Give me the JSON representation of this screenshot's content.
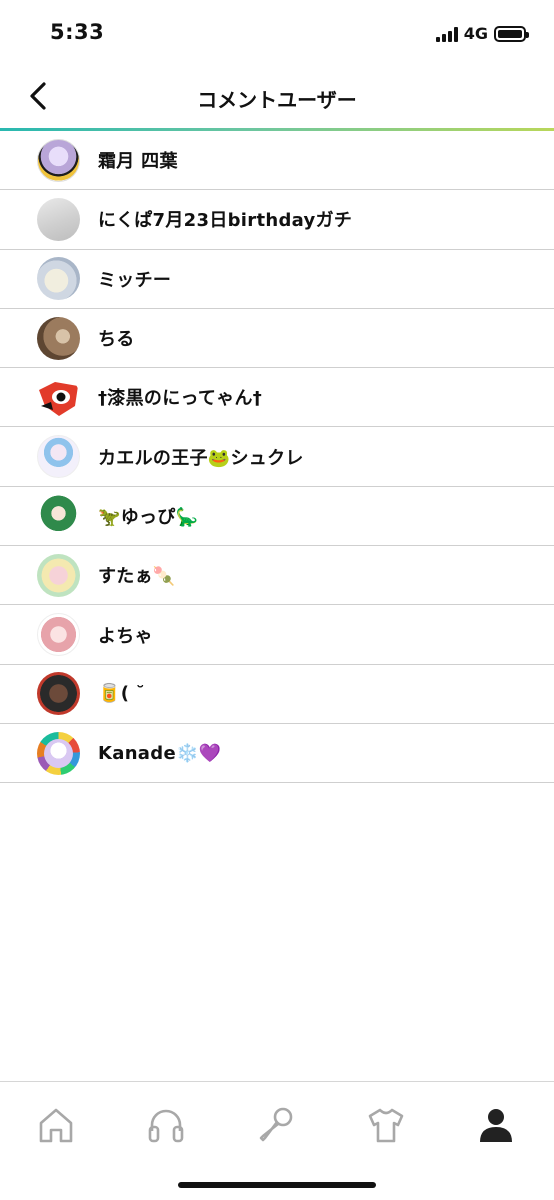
{
  "status_bar": {
    "time": "5:33",
    "network": "4G"
  },
  "header": {
    "title": "コメントユーザー",
    "back_icon": "chevron-left-icon",
    "accent_gradient": [
      "#29b8b0",
      "#b9d75a"
    ]
  },
  "users": [
    {
      "name": "霜月 四葉"
    },
    {
      "name": "にくぱ7月23日birthdayガチ"
    },
    {
      "name": "ミッチー"
    },
    {
      "name": "ちる"
    },
    {
      "name": "†漆黒のにってゃん†"
    },
    {
      "name": "カエルの王子🐸シュクレ"
    },
    {
      "name": "🦖ゆっぴ🦕"
    },
    {
      "name": "すたぁ🍡"
    },
    {
      "name": "よちゃ"
    },
    {
      "name": "🥫( ˘"
    },
    {
      "name": "Kanade❄️💜"
    }
  ],
  "tab_bar": {
    "tabs": [
      {
        "icon": "home-icon",
        "active": false
      },
      {
        "icon": "headphones-icon",
        "active": false
      },
      {
        "icon": "microphone-icon",
        "active": false
      },
      {
        "icon": "tshirt-icon",
        "active": false
      },
      {
        "icon": "person-icon",
        "active": true
      }
    ],
    "active_color": "#222222",
    "inactive_color": "#a8a8a8"
  }
}
